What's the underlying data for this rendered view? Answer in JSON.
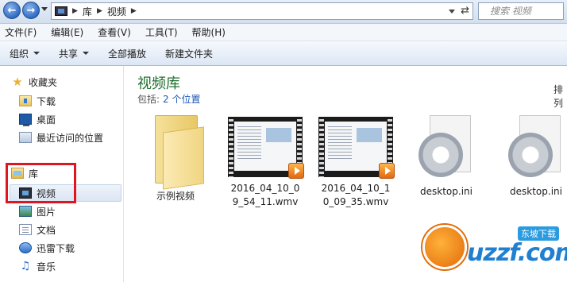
{
  "address": {
    "crumbs": [
      "库",
      "视频"
    ],
    "search_placeholder": "搜索 视频"
  },
  "menu": [
    "文件(F)",
    "编辑(E)",
    "查看(V)",
    "工具(T)",
    "帮助(H)"
  ],
  "toolbar": {
    "organize": "组织",
    "share": "共享",
    "play_all": "全部播放",
    "new_folder": "新建文件夹"
  },
  "nav": {
    "favorites": "收藏夹",
    "downloads": "下载",
    "desktop": "桌面",
    "recent": "最近访问的位置",
    "libraries": "库",
    "videos": "视频",
    "pictures": "图片",
    "documents": "文档",
    "xunlei": "迅雷下载",
    "music": "音乐"
  },
  "main": {
    "title": "视频库",
    "includes_label": "包括:",
    "includes_link": "2 个位置",
    "arrange_label": "排列",
    "items": [
      {
        "label": "示例视频"
      },
      {
        "label": "2016_04_10_09_54_11.wmv"
      },
      {
        "label": "2016_04_10_10_09_35.wmv"
      },
      {
        "label": "desktop.ini"
      },
      {
        "label": "desktop.ini"
      }
    ]
  },
  "watermark": {
    "text": "uzzf.com",
    "tag": "东坡下载"
  },
  "colors": {
    "title_green": "#1e6f2e",
    "link_blue": "#1f5ab6",
    "highlight_red": "#e0161f"
  }
}
